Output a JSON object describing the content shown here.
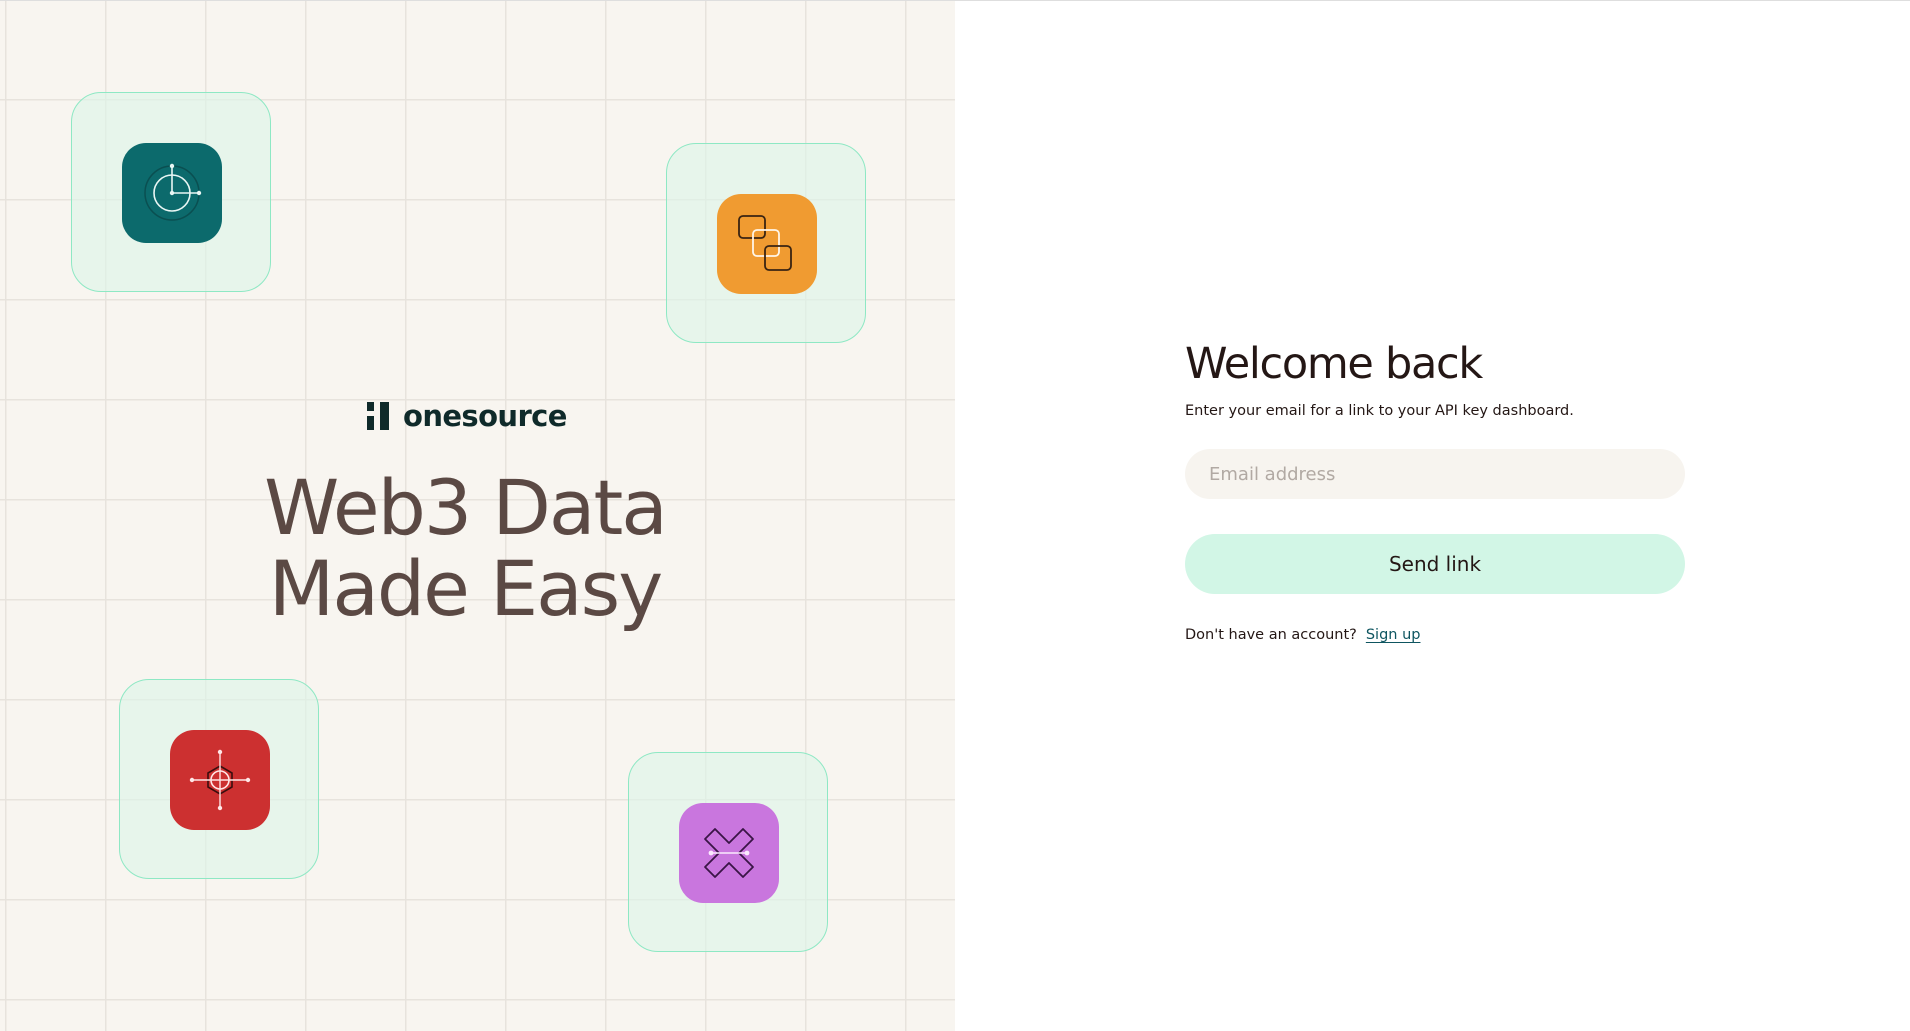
{
  "brand": {
    "name": "onesource",
    "color": "#0f2a2a"
  },
  "hero": {
    "line1": "Web3 Data",
    "line2": "Made Easy",
    "color": "#5b4944"
  },
  "tiles": [
    {
      "icon": "clock-node-icon",
      "color": "#0c6a6c"
    },
    {
      "icon": "overlapping-squares-icon",
      "color": "#f09b31"
    },
    {
      "icon": "hexagon-nodes-icon",
      "color": "#cc3030"
    },
    {
      "icon": "crossed-links-icon",
      "color": "#c976de"
    }
  ],
  "login": {
    "title": "Welcome back",
    "subtitle": "Enter your email for a link to your API key dashboard.",
    "email_placeholder": "Email address",
    "email_value": "",
    "send_label": "Send link",
    "signup_prompt": "Don't have an account?",
    "signup_link": "Sign up"
  },
  "colors": {
    "panel_bg": "#f8f5f0",
    "tile_border": "#8ee8c4",
    "button_bg": "#d2f6e6",
    "link": "#0e5560"
  }
}
